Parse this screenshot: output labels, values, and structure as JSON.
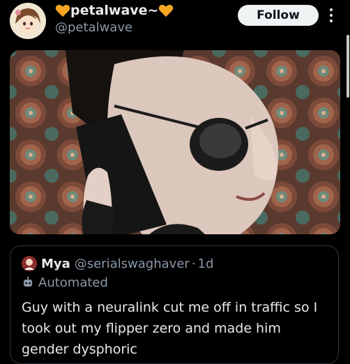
{
  "header": {
    "display_name": "petalwave~",
    "handle": "@petalwave",
    "follow_label": "Follow",
    "heart_color": "#f5a623"
  },
  "media": {
    "description_icon": "photo"
  },
  "quote": {
    "name": "Mya",
    "handle": "@serialswaghaver",
    "separator": "·",
    "time": "1d",
    "automated_label": "Automated",
    "text": "Guy with a neuralink cut me off in traffic so I took out my flipper zero and made him gender dysphoric"
  },
  "colors": {
    "background": "#000000",
    "text_primary": "#e7e9ea",
    "text_secondary": "#8b98a5",
    "follow_bg": "#eff3f4",
    "border": "#2f3336"
  }
}
